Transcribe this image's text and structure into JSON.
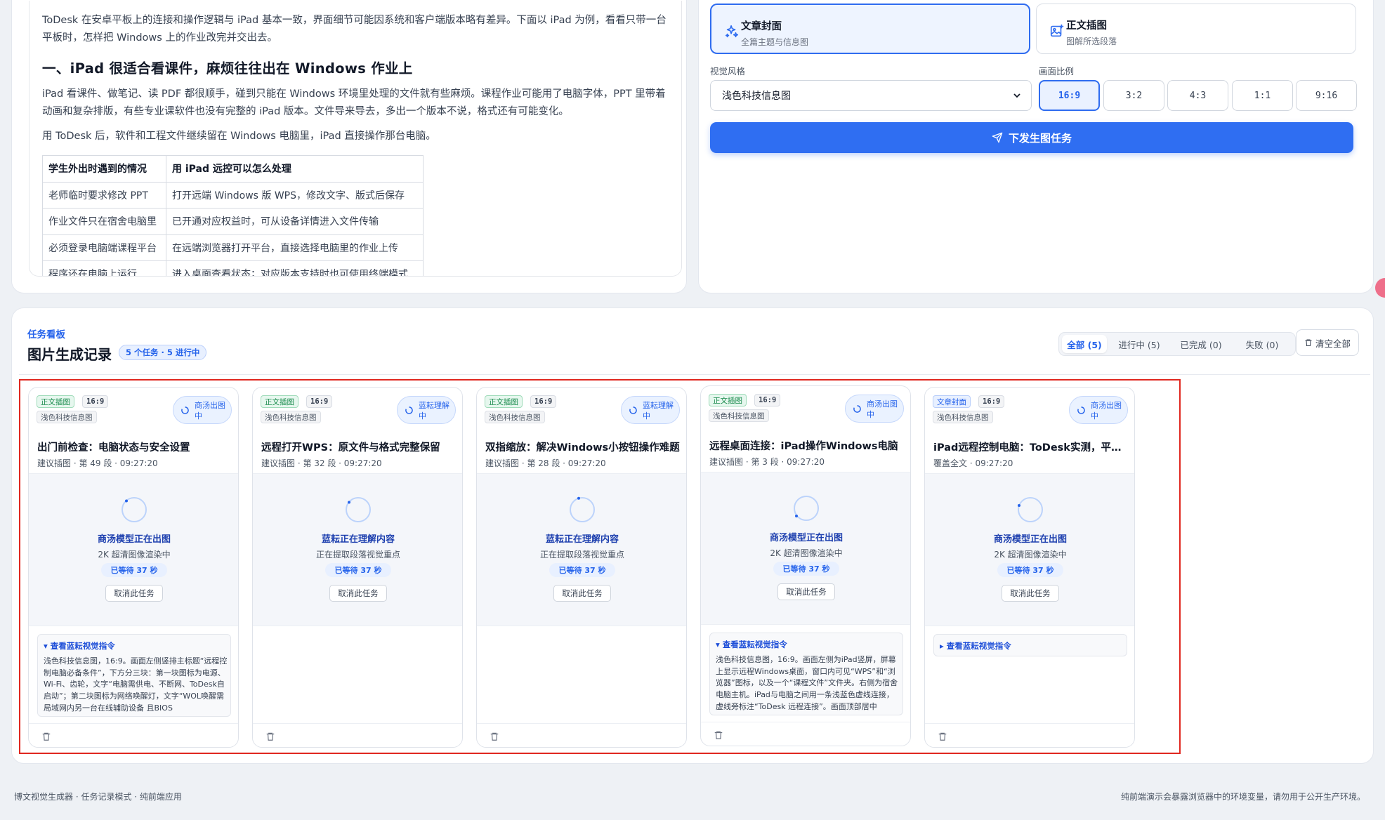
{
  "editor": {
    "intro": "ToDesk 在安卓平板上的连接和操作逻辑与 iPad 基本一致，界面细节可能因系统和客户端版本略有差异。下面以 iPad 为例，看看只带一台平板时，怎样把 Windows 上的作业改完并交出去。",
    "heading": "一、iPad 很适合看课件，麻烦往往出在 Windows 作业上",
    "para1": "iPad 看课件、做笔记、读 PDF 都很顺手，碰到只能在 Windows 环境里处理的文件就有些麻烦。课程作业可能用了电脑字体，PPT 里带着动画和复杂排版，有些专业课软件也没有完整的 iPad 版本。文件导来导去，多出一个版本不说，格式还有可能变化。",
    "para2": "用 ToDesk 后，软件和工程文件继续留在 Windows 电脑里，iPad 直接操作那台电脑。",
    "table": {
      "headers": [
        "学生外出时遇到的情况",
        "用 iPad 远控可以怎么处理"
      ],
      "rows": [
        [
          "老师临时要求修改 PPT",
          "打开远端 Windows 版 WPS，修改文字、版式后保存"
        ],
        [
          "作业文件只在宿舍电脑里",
          "已开通对应权益时，可从设备详情进入文件传输"
        ],
        [
          "必须登录电脑端课程平台",
          "在远端浏览器打开平台，直接选择电脑里的作业上传"
        ],
        [
          "程序还在电脑上运行",
          "进入桌面查看状态；对应版本支持时也可使用终端模式"
        ]
      ]
    }
  },
  "generator": {
    "types": [
      {
        "title": "文章封面",
        "sub": "全篇主题与信息图",
        "icon": "sparkles-icon"
      },
      {
        "title": "正文插图",
        "sub": "图解所选段落",
        "icon": "image-plus-icon"
      }
    ],
    "style_label": "视觉风格",
    "style_value": "浅色科技信息图",
    "ratio_label": "画面比例",
    "ratios": [
      "16:9",
      "3:2",
      "4:3",
      "1:1",
      "9:16"
    ],
    "selected_ratio": "16:9",
    "submit_label": "下发生图任务"
  },
  "board": {
    "kicker": "任务看板",
    "title": "图片生成记录",
    "count_badge": "5 个任务 · 5 进行中",
    "filters": [
      "全部 (5)",
      "进行中 (5)",
      "已完成 (0)",
      "失败 (0)"
    ],
    "clear_label": "清空全部",
    "cards": [
      {
        "type": "正文插图",
        "ratio": "16:9",
        "style": "浅色科技信息图",
        "status": "商汤出图中",
        "title": "出门前检查：电脑状态与安全设置",
        "meta": "建议插图 · 第 49 段 · 09:27:20",
        "stage_title": "商汤模型正在出图",
        "stage_sub": "2K 超清图像渲染中",
        "wait": "已等待  37  秒",
        "cancel": "取消此任务",
        "prompt_toggle": "▾ 查看蓝耘视觉指令",
        "prompt": "浅色科技信息图，16:9。画面左侧竖排主标题“远程控制电脑必备条件”，下方分三块：第一块图标为电源、Wi-Fi、齿轮，文字“电脑需供电、不断网、ToDesk自启动”；第二块图标为网络唤醒灯，文字“WOL唤醒需局域网内另一台在线辅助设备 且BIOS"
      },
      {
        "type": "正文插图",
        "ratio": "16:9",
        "style": "浅色科技信息图",
        "status": "蓝耘理解中",
        "title": "远程打开WPS：原文件与格式完整保留",
        "meta": "建议插图 · 第 32 段 · 09:27:20",
        "stage_title": "蓝耘正在理解内容",
        "stage_sub": "正在提取段落视觉重点",
        "wait": "已等待  37  秒",
        "cancel": "取消此任务",
        "prompt_toggle": "",
        "prompt": ""
      },
      {
        "type": "正文插图",
        "ratio": "16:9",
        "style": "浅色科技信息图",
        "status": "蓝耘理解中",
        "title": "双指缩放：解决Windows小按钮操作难题",
        "meta": "建议插图 · 第 28 段 · 09:27:20",
        "stage_title": "蓝耘正在理解内容",
        "stage_sub": "正在提取段落视觉重点",
        "wait": "已等待  37  秒",
        "cancel": "取消此任务",
        "prompt_toggle": "",
        "prompt": ""
      },
      {
        "type": "正文插图",
        "ratio": "16:9",
        "style": "浅色科技信息图",
        "status": "商汤出图中",
        "title": "远程桌面连接：iPad操作Windows电脑",
        "meta": "建议插图 · 第 3 段 · 09:27:20",
        "stage_title": "商汤模型正在出图",
        "stage_sub": "2K 超清图像渲染中",
        "wait": "已等待  37  秒",
        "cancel": "取消此任务",
        "prompt_toggle": "▾ 查看蓝耘视觉指令",
        "prompt": "浅色科技信息图，16:9。画面左侧为iPad竖屏，屏幕上显示远程Windows桌面，窗口内可见“WPS”和“浏览器”图标，以及一个“课程文件”文件夹。右侧为宿舍电脑主机。iPad与电脑之间用一条浅蓝色虚线连接，虚线旁标注“ToDesk 远程连接”。画面顶部居中"
      },
      {
        "type": "文章封面",
        "ratio": "16:9",
        "style": "浅色科技信息图",
        "status": "商汤出图中",
        "title": "iPad远程控制电脑：ToDesk实测，平板…",
        "meta": "覆盖全文 · 09:27:20",
        "stage_title": "商汤模型正在出图",
        "stage_sub": "2K 超清图像渲染中",
        "wait": "已等待  37  秒",
        "cancel": "取消此任务",
        "prompt_toggle": "▸ 查看蓝耘视觉指令",
        "prompt": ""
      }
    ]
  },
  "footer": {
    "left": "博文视觉生成器 · 任务记录模式 · 纯前端应用",
    "right": "纯前端演示会暴露浏览器中的环境变量，请勿用于公开生产环境。"
  },
  "colors": {
    "accent": "#2f6ef2",
    "success": "#17894a",
    "highlight_frame": "#e0271f"
  }
}
